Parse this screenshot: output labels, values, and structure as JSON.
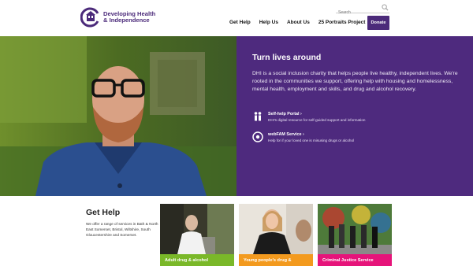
{
  "header": {
    "logo_line1": "Developing Health",
    "logo_line2": "& Independence",
    "search_placeholder": "Search",
    "nav": [
      "Get Help",
      "Help Us",
      "About Us",
      "25 Portraits Project"
    ],
    "donate": "Donate"
  },
  "hero": {
    "title": "Turn lives around",
    "text": "DHI is a social inclusion charity that helps people live healthy, independent lives. We're rooted in the communities we support, offering help with housing and homelessness, mental health, employment and skills, and drug and alcohol recovery.",
    "links": [
      {
        "title": "Self-help Portal",
        "desc": "DHI's digital resource for self-guided support and information",
        "icon": "people-icon"
      },
      {
        "title": "webFAM Service",
        "desc": "Help for if your loved one is misusing drugs or alcohol",
        "icon": "webfam-icon"
      }
    ]
  },
  "gethelp": {
    "title": "Get Help",
    "text": "We offer a range of services in Bath & North East Somerset, Bristol, Wiltshire, South Gloucestershire and Somerset.",
    "cards": [
      {
        "label": "Adult drug & alcohol",
        "color": "#7ab829"
      },
      {
        "label": "Young people's drug &",
        "color": "#f39a1e"
      },
      {
        "label": "Criminal Justice Service",
        "color": "#e6147a"
      }
    ]
  },
  "colors": {
    "brand_purple": "#4e2a7e"
  }
}
